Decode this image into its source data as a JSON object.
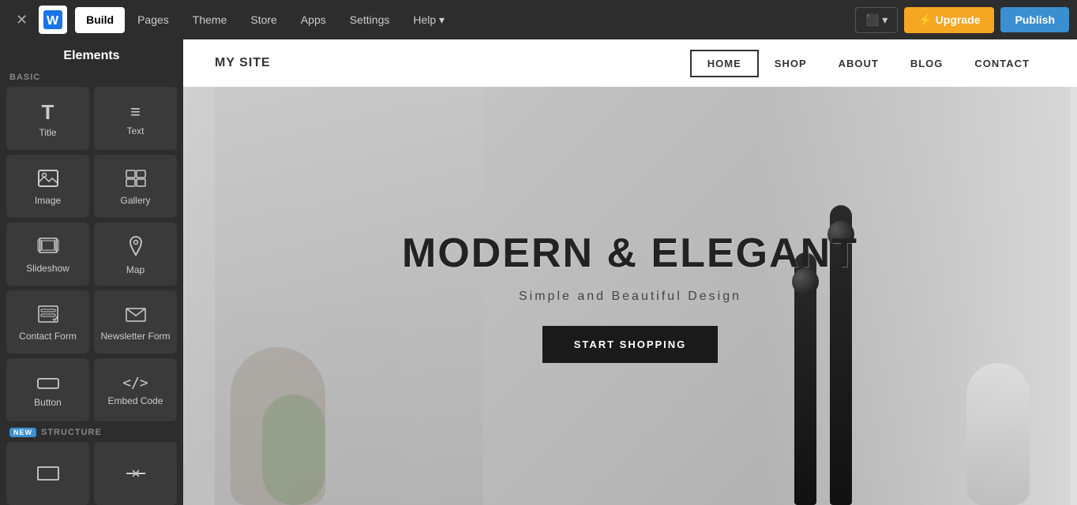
{
  "topnav": {
    "close_label": "✕",
    "logo_text": "W",
    "nav_items": [
      {
        "id": "build",
        "label": "Build",
        "active": true
      },
      {
        "id": "pages",
        "label": "Pages",
        "active": false
      },
      {
        "id": "theme",
        "label": "Theme",
        "active": false
      },
      {
        "id": "store",
        "label": "Store",
        "active": false
      },
      {
        "id": "apps",
        "label": "Apps",
        "active": false
      },
      {
        "id": "settings",
        "label": "Settings",
        "active": false
      },
      {
        "id": "help",
        "label": "Help ▾",
        "active": false
      }
    ],
    "device_label": "⬛ ▾",
    "upgrade_label": "⚡ Upgrade",
    "publish_label": "Publish"
  },
  "sidebar": {
    "title": "Elements",
    "sections": [
      {
        "id": "basic",
        "label": "BASIC",
        "new_badge": false,
        "items": [
          {
            "id": "title",
            "label": "Title",
            "icon": "T"
          },
          {
            "id": "text",
            "label": "Text",
            "icon": "≡"
          },
          {
            "id": "image",
            "label": "Image",
            "icon": "🖼"
          },
          {
            "id": "gallery",
            "label": "Gallery",
            "icon": "⊞"
          },
          {
            "id": "slideshow",
            "label": "Slideshow",
            "icon": "▣"
          },
          {
            "id": "map",
            "label": "Map",
            "icon": "📍"
          },
          {
            "id": "contact-form",
            "label": "Contact Form",
            "icon": "☑"
          },
          {
            "id": "newsletter-form",
            "label": "Newsletter Form",
            "icon": "✉"
          },
          {
            "id": "button",
            "label": "Button",
            "icon": "▬"
          },
          {
            "id": "embed-code",
            "label": "Embed Code",
            "icon": "</>"
          }
        ]
      },
      {
        "id": "structure",
        "label": "STRUCTURE",
        "new_badge": true,
        "items": [
          {
            "id": "box",
            "label": "",
            "icon": "▭"
          },
          {
            "id": "divider",
            "label": "",
            "icon": "⊟"
          }
        ]
      }
    ]
  },
  "site": {
    "logo": "MY SITE",
    "nav_items": [
      {
        "id": "home",
        "label": "HOME",
        "active": true
      },
      {
        "id": "shop",
        "label": "SHOP",
        "active": false
      },
      {
        "id": "about",
        "label": "ABOUT",
        "active": false
      },
      {
        "id": "blog",
        "label": "BLOG",
        "active": false
      },
      {
        "id": "contact",
        "label": "CONTACT",
        "active": false
      }
    ],
    "hero": {
      "title": "MODERN & ELEGANT",
      "subtitle": "Simple and Beautiful Design",
      "cta_label": "START SHOPPING"
    }
  }
}
